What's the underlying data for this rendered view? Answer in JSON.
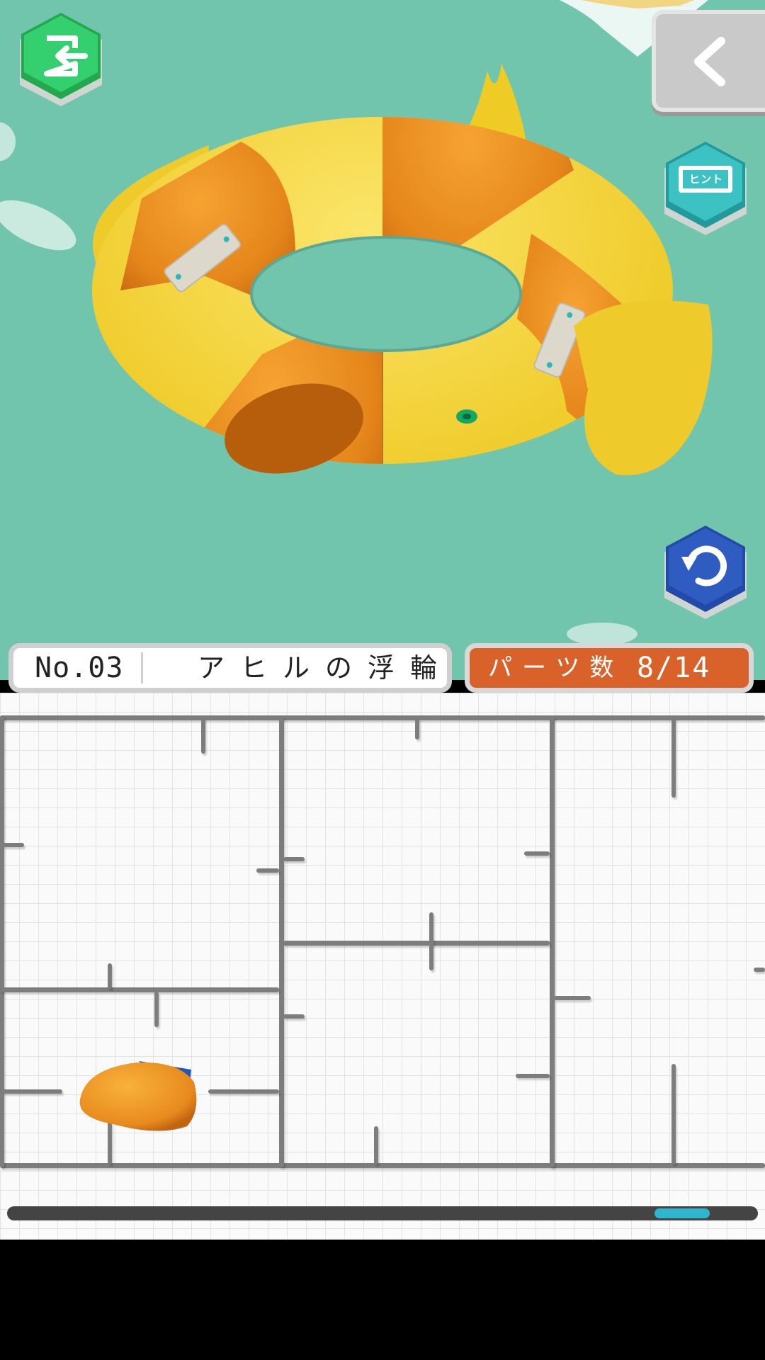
{
  "puzzle": {
    "number_label": "No.03",
    "name": "アヒルの浮輪",
    "parts_label": "パーツ数",
    "parts_count": "8/14"
  },
  "buttons": {
    "exit_icon": "exit-door-icon",
    "back_icon": "chevron-left-icon",
    "hint_icon": "hint-film-icon",
    "hint_text": "ヒント",
    "undo_icon": "undo-arrow-icon"
  },
  "scroll": {
    "position_fraction": 0.94
  },
  "colors": {
    "scene_bg": "#72c5ad",
    "exit_green": "#2fc46a",
    "hint_teal": "#2fb6b8",
    "undo_blue": "#2f5cc0",
    "parts_bar": "#d9622a",
    "duck_yellow": "#f2d43a",
    "duck_orange": "#e88a1e"
  }
}
